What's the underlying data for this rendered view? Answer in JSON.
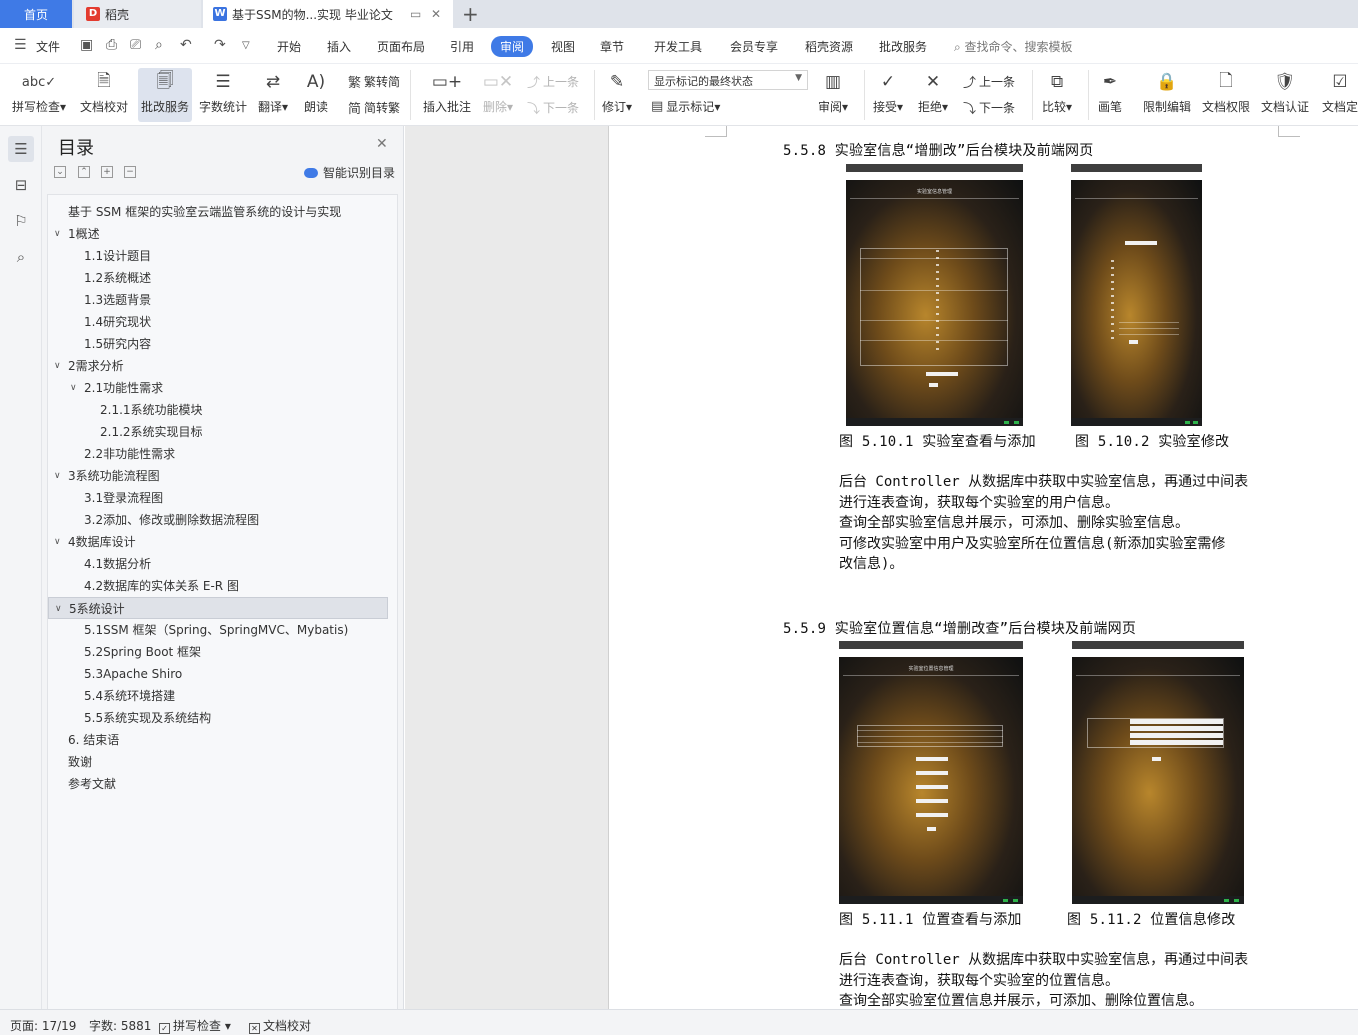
{
  "tabs": {
    "home": "首页",
    "daoke": "稻壳",
    "doc": "基于SSM的物...实现 毕业论文"
  },
  "menu": {
    "file": "文件",
    "items": [
      "开始",
      "插入",
      "页面布局",
      "引用",
      "审阅",
      "视图",
      "章节",
      "开发工具",
      "会员专享",
      "稻壳资源",
      "批改服务"
    ],
    "active_index": 4,
    "search": "查找命令、搜索模板"
  },
  "ribbon": {
    "spell": "拼写检查",
    "proof": "文档校对",
    "correct": "批改服务",
    "wordcount": "字数统计",
    "translate": "翻译",
    "read": "朗读",
    "to_trad": "繁转简",
    "to_simp": "简转繁",
    "insert_comment": "插入批注",
    "delete": "删除",
    "prev_comment": "上一条",
    "next_comment": "下一条",
    "revise": "修订",
    "markup_state": "显示标记的最终状态",
    "show_markup": "显示标记",
    "review": "审阅",
    "accept": "接受",
    "reject": "拒绝",
    "prev_change": "上一条",
    "next_change": "下一条",
    "compare": "比较",
    "pen": "画笔",
    "restrict": "限制编辑",
    "permission": "文档权限",
    "certify": "文档认证",
    "finalize": "文档定"
  },
  "toc": {
    "title": "目录",
    "smart": "智能识别目录",
    "items": [
      {
        "text": "基于 SSM 框架的实验室云端监管系统的设计与实现",
        "level": 0,
        "arrow": ""
      },
      {
        "text": "1概述",
        "level": 0,
        "arrow": "v"
      },
      {
        "text": "1.1设计题目",
        "level": 1,
        "arrow": ""
      },
      {
        "text": "1.2系统概述",
        "level": 1,
        "arrow": ""
      },
      {
        "text": "1.3选题背景",
        "level": 1,
        "arrow": ""
      },
      {
        "text": "1.4研究现状",
        "level": 1,
        "arrow": ""
      },
      {
        "text": "1.5研究内容",
        "level": 1,
        "arrow": ""
      },
      {
        "text": "2需求分析",
        "level": 0,
        "arrow": "v"
      },
      {
        "text": "2.1功能性需求",
        "level": 1,
        "arrow": "v"
      },
      {
        "text": "2.1.1系统功能模块",
        "level": 2,
        "arrow": ""
      },
      {
        "text": "2.1.2系统实现目标",
        "level": 2,
        "arrow": ""
      },
      {
        "text": "2.2非功能性需求",
        "level": 1,
        "arrow": ""
      },
      {
        "text": "3系统功能流程图",
        "level": 0,
        "arrow": "v"
      },
      {
        "text": "3.1登录流程图",
        "level": 1,
        "arrow": ""
      },
      {
        "text": "3.2添加、修改或删除数据流程图",
        "level": 1,
        "arrow": ""
      },
      {
        "text": "4数据库设计",
        "level": 0,
        "arrow": "v"
      },
      {
        "text": "4.1数据分析",
        "level": 1,
        "arrow": ""
      },
      {
        "text": "4.2数据库的实体关系 E-R 图",
        "level": 1,
        "arrow": ""
      },
      {
        "text": "5系统设计",
        "level": 0,
        "arrow": "v",
        "selected": true
      },
      {
        "text": "5.1SSM 框架（Spring、SpringMVC、Mybatis)",
        "level": 1,
        "arrow": ""
      },
      {
        "text": "5.2Spring Boot 框架",
        "level": 1,
        "arrow": ""
      },
      {
        "text": "5.3Apache Shiro",
        "level": 1,
        "arrow": ""
      },
      {
        "text": "5.4系统环境搭建",
        "level": 1,
        "arrow": ""
      },
      {
        "text": "5.5系统实现及系统结构",
        "level": 1,
        "arrow": ""
      },
      {
        "text": "6. 结束语",
        "level": 0,
        "arrow": ""
      },
      {
        "text": "致谢",
        "level": 0,
        "arrow": ""
      },
      {
        "text": "参考文献",
        "level": 0,
        "arrow": ""
      }
    ]
  },
  "doc": {
    "h1": "5.5.8  实验室信息“增删改”后台模块及前端网页",
    "fig1_title": "实验室信息管理",
    "cap1a": "图 5.10.1 实验室查看与添加",
    "cap1b": "图 5.10.2 实验室修改",
    "para1": [
      "后台 Controller 从数据库中获取中实验室信息，再通过中间表",
      "进行连表查询，获取每个实验室的用户信息。",
      "查询全部实验室信息并展示，可添加、删除实验室信息。",
      "可修改实验室中用户及实验室所在位置信息(新添加实验室需修",
      "改信息)。"
    ],
    "h2": "5.5.9  实验室位置信息“增删改查”后台模块及前端网页",
    "fig3_title": "实验室位置信息管理",
    "cap2a": "图 5.11.1 位置查看与添加",
    "cap2b": "图 5.11.2 位置信息修改",
    "para2": [
      "后台 Controller 从数据库中获取中实验室信息，再通过中间表",
      "进行连表查询，获取每个实验室的位置信息。",
      "查询全部实验室位置信息并展示，可添加、删除位置信息。"
    ]
  },
  "status": {
    "page": "页面: 17/19",
    "words": "字数: 5881",
    "spell": "拼写检查",
    "proof": "文档校对"
  },
  "colors": {
    "accent": "#3f7ae6",
    "toc_selected": "#dfe2e8",
    "canvas": "#eaeaea"
  }
}
